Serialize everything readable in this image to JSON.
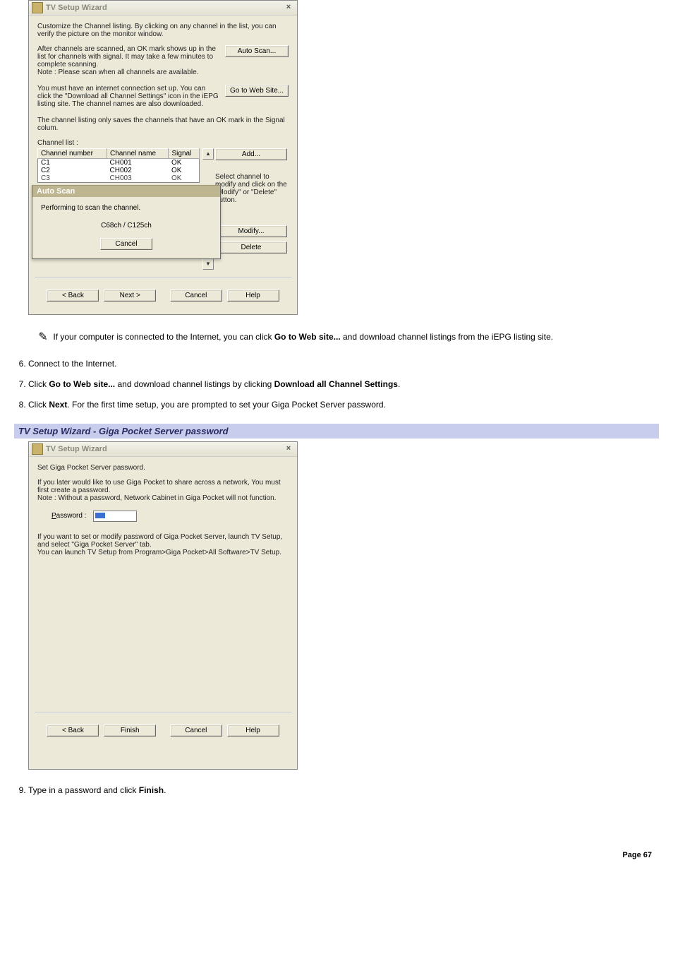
{
  "dlg1": {
    "title": "TV Setup Wizard",
    "close": "×",
    "p1": "Customize the Channel listing. By clicking on any channel in the list, you can verify the picture on the monitor window.",
    "scan_text": "After channels are scanned, an OK mark shows up in the list for channels with signal. It may take a few minutes to complete scanning.\nNote : Please scan when all channels are available.",
    "scan_btn": "Auto Scan...",
    "web_text": "You must have an internet connection set up. You can click the \"Download all Channel Settings\" icon in the iEPG listing site. The channel names are also downloaded.",
    "web_btn": "Go to Web Site...",
    "p2": "The channel listing only saves the channels that have an OK mark in the Signal colum.",
    "list_label": "Channel list :",
    "cols": {
      "c1": "Channel number",
      "c2": "Channel name",
      "c3": "Signal"
    },
    "rows": [
      {
        "num": "C1",
        "name": "CH001",
        "sig": "OK"
      },
      {
        "num": "C2",
        "name": "CH002",
        "sig": "OK"
      },
      {
        "num": "C3",
        "name": "CH003",
        "sig": "OK"
      }
    ],
    "add_btn": "Add...",
    "side_help": "Select channel to modify and click on the \"Modify\" or \"Delete\" button.",
    "modify_btn": "Modify...",
    "delete_btn": "Delete",
    "overlay": {
      "title": "Auto Scan",
      "msg": "Performing to scan the channel.",
      "progress": "C68ch / C125ch",
      "cancel": "Cancel"
    },
    "nav": {
      "back": "< Back",
      "next": "Next >",
      "cancel": "Cancel",
      "help": "Help"
    }
  },
  "doc": {
    "note": "If your computer is connected to the Internet, you can click ",
    "note_bold1": "Go to Web site...",
    "note_tail": " and download channel listings from the iEPG listing site.",
    "step6": "Connect to the Internet.",
    "step7_a": "Click ",
    "step7_b1": "Go to Web site...",
    "step7_mid": " and download channel listings by clicking ",
    "step7_b2": "Download all Channel Settings",
    "step7_end": ".",
    "step8_a": "Click ",
    "step8_b": "Next",
    "step8_end": ". For the first time setup, you are prompted to set your Giga Pocket Server password.",
    "caption": "TV Setup Wizard - Giga Pocket Server password",
    "step9_a": "Type in a password and click ",
    "step9_b": "Finish",
    "step9_end": ".",
    "page": "Page 67"
  },
  "dlg2": {
    "title": "TV Setup Wizard",
    "close": "×",
    "p1": "Set Giga Pocket Server password.",
    "p2": "If you later would like to use Giga Pocket to share across a network, You must first create a password.\nNote : Without a password, Network Cabinet in Giga Pocket will not function.",
    "pw_label": "Password :",
    "p3": "If you want to set or modify password of Giga Pocket Server, launch TV Setup, and select \"Giga Pocket Server\" tab.\nYou can launch TV Setup from Program>Giga Pocket>All Software>TV Setup.",
    "nav": {
      "back": "< Back",
      "finish": "Finish",
      "cancel": "Cancel",
      "help": "Help"
    }
  }
}
